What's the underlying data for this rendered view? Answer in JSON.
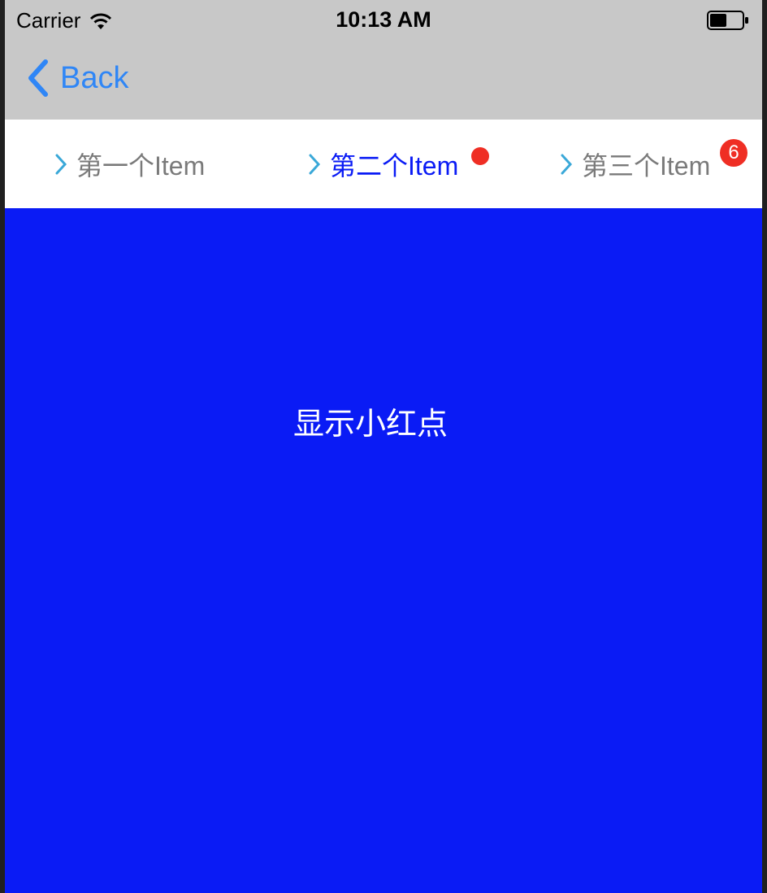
{
  "status_bar": {
    "carrier": "Carrier",
    "time": "10:13 AM"
  },
  "nav_bar": {
    "back_label": "Back",
    "accent_color": "#2f86f6"
  },
  "tabs": [
    {
      "label": "第一个Item",
      "active": false
    },
    {
      "label": "第二个Item",
      "active": true,
      "badge": "dot"
    },
    {
      "label": "第三个Item",
      "active": false,
      "badge_count": "6"
    }
  ],
  "content": {
    "label": "显示小红点",
    "background_color": "#0a1bf5"
  },
  "colors": {
    "badge": "#ef2e24",
    "active_tab": "#0a1bf5",
    "inactive_tab": "#7a7a7a",
    "chevron": "#3aa8d8"
  },
  "icons": [
    "wifi-icon",
    "battery-icon",
    "back-chevron-icon",
    "chevron-right-icon"
  ]
}
